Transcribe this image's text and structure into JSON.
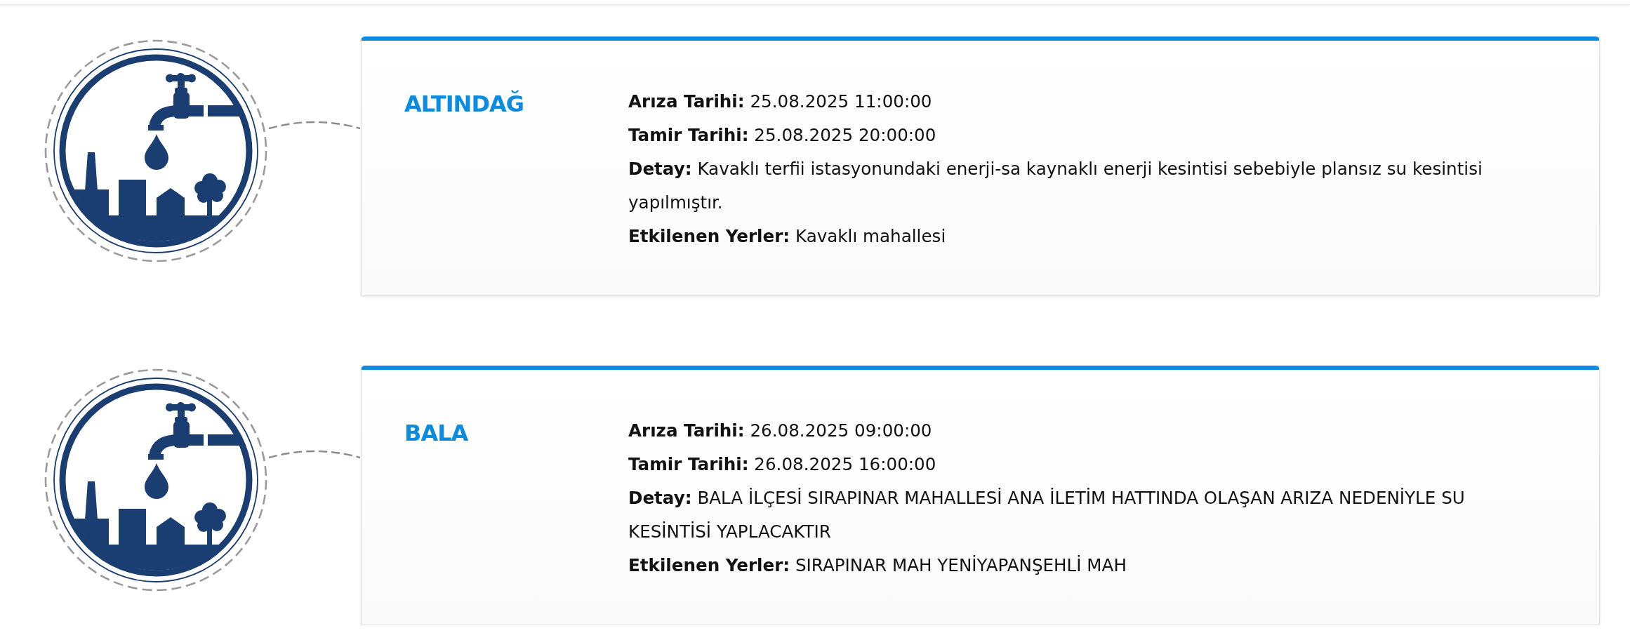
{
  "outages": [
    {
      "district": "ALTINDAĞ",
      "details": [
        {
          "label": "Arıza Tarihi:",
          "value": "25.08.2025 11:00:00"
        },
        {
          "label": "Tamir Tarihi:",
          "value": "25.08.2025 20:00:00"
        },
        {
          "label": "Detay:",
          "value": "Kavaklı terfii istasyonundaki enerji-sa kaynaklı enerji kesintisi sebebiyle plansız su kesintisi yapılmıştır."
        },
        {
          "label": "Etkilenen Yerler:",
          "value": "Kavaklı mahallesi"
        }
      ]
    },
    {
      "district": "BALA",
      "details": [
        {
          "label": "Arıza Tarihi:",
          "value": "26.08.2025 09:00:00"
        },
        {
          "label": "Tamir Tarihi:",
          "value": "26.08.2025 16:00:00"
        },
        {
          "label": "Detay:",
          "value": "BALA İLÇESİ SIRAPINAR MAHALLESİ ANA İLETİM HATTINDA OLAŞAN ARIZA NEDENİYLE SU KESİNTİSİ YAPLACAKTIR"
        },
        {
          "label": "Etkilenen Yerler:",
          "value": "SIRAPINAR MAH YENİYAPANŞEHLİ MAH"
        }
      ]
    }
  ]
}
